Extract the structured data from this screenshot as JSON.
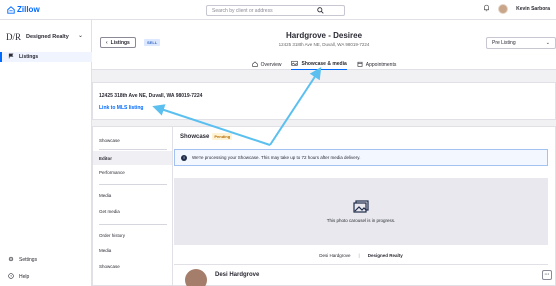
{
  "app": {
    "logo_text": "Zillow"
  },
  "search": {
    "placeholder": "Search by client or address"
  },
  "user": {
    "name": "Kevin Sarbora"
  },
  "sidebar": {
    "brand_mark": "D/R",
    "brand_name": "Designed Realty",
    "items": [
      {
        "label": "Listings"
      }
    ],
    "bottom": [
      {
        "label": "Settings"
      },
      {
        "label": "Help"
      }
    ]
  },
  "header": {
    "back_label": "Listings",
    "sell_tag": "SELL",
    "title": "Hardgrove - Desiree",
    "address": "12425 318th Ave NE, Duvall, WA 98019-7224",
    "status_value": "Pre Listing",
    "tabs": [
      {
        "label": "Overview"
      },
      {
        "label": "Showcase & media"
      },
      {
        "label": "Appointments"
      }
    ]
  },
  "address_card": {
    "address": "12425 318th Ave NE, Duvall, WA 98019-7224",
    "mls_link": "Link to MLS listing"
  },
  "subnav": {
    "items": [
      {
        "label": "Showcase"
      },
      {
        "label": "Editor"
      },
      {
        "label": "Performance"
      },
      {
        "label": "Media"
      },
      {
        "label": "Get media"
      },
      {
        "label": "Order history"
      },
      {
        "label": "Media"
      },
      {
        "label": "Showcase"
      }
    ]
  },
  "showcase": {
    "title": "Showcase",
    "status": "Pending",
    "info_message": "We're processing your Showcase. This may take up to 72 hours after media delivery.",
    "photo_message": "This photo carousel is in progress.",
    "agent_name_short": "Desi Hardgrove",
    "brokerage": "Designed Realty",
    "agent_name": "Desi Hardgrove",
    "more_label": "···"
  },
  "colors": {
    "accent": "#006aff",
    "annotation_arrow": "#5bc0f0"
  }
}
